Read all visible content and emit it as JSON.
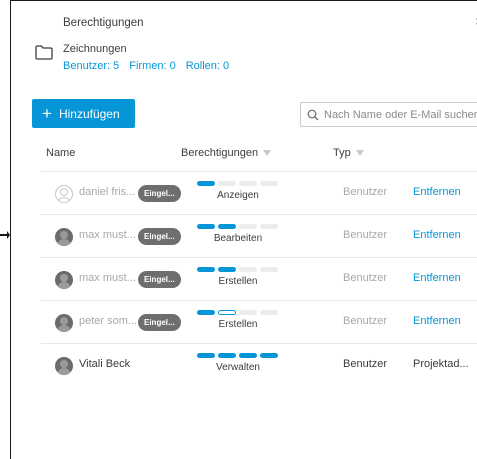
{
  "dialog": {
    "title": "Berechtigungen",
    "close_glyph": "×",
    "folder_icon": "folder-icon",
    "folder_name": "Zeichnungen",
    "counts": [
      "Benutzer: 5",
      "Firmen: 0",
      "Rollen: 0"
    ]
  },
  "toolbar": {
    "add_label": "Hinzufügen",
    "add_glyph": "+",
    "search_placeholder": "Nach Name oder E-Mail suchen",
    "search_icon": "search-icon"
  },
  "table": {
    "headers": {
      "name": "Name",
      "permissions": "Berechtigungen",
      "type": "Typ"
    },
    "rows": [
      {
        "name": "daniel fris...",
        "badge": "Eingel...",
        "avatar": "user-outline-icon",
        "level": "Anzeigen",
        "level_value": 1,
        "type": "Benutzer",
        "action": "Entfernen"
      },
      {
        "name": "max must...",
        "badge": "Eingel...",
        "avatar": "user-avatar-icon",
        "level": "Bearbeiten",
        "level_value": 2,
        "type": "Benutzer",
        "action": "Entfernen"
      },
      {
        "name": "max must...",
        "badge": "Eingel...",
        "avatar": "user-avatar-icon",
        "level": "Erstellen",
        "level_value": 2,
        "type": "Benutzer",
        "action": "Entfernen"
      },
      {
        "name": "peter som...",
        "badge": "Eingel...",
        "avatar": "user-avatar-icon",
        "level": "Erstellen",
        "level_value": 1.5,
        "type": "Benutzer",
        "action": "Entfernen"
      },
      {
        "name": "Vitali Beck",
        "badge": "",
        "avatar": "user-avatar-icon",
        "level": "Verwalten",
        "level_value": 4,
        "type": "Benutzer",
        "action": "Projektad..."
      }
    ]
  },
  "colors": {
    "accent": "#0696d7",
    "muted": "#a8a8a8",
    "badge": "#6e6e6e"
  }
}
